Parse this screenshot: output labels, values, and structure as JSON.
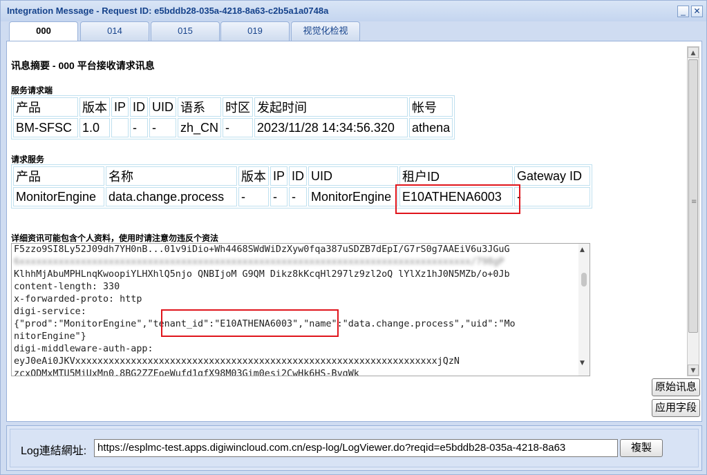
{
  "window": {
    "title": "Integration Message - Request ID: e5bddb28-035a-4218-8a63-c2b5a1a0748a",
    "minimize_label": "_",
    "close_label": "✕"
  },
  "tabs": [
    {
      "label": "000",
      "active": true
    },
    {
      "label": "014"
    },
    {
      "label": "015"
    },
    {
      "label": "019"
    },
    {
      "label": "视觉化检视"
    }
  ],
  "summary": {
    "heading": "讯息摘要 - 000 平台接收请求讯息"
  },
  "requester": {
    "title": "服务请求端",
    "headers": [
      "产品",
      "版本",
      "IP",
      "ID",
      "UID",
      "语系",
      "时区",
      "发起时间",
      "帐号"
    ],
    "values": [
      "BM-SFSC",
      "1.0",
      "",
      "-",
      "-",
      "zh_CN",
      "-",
      "2023/11/28 14:34:56.320",
      "athena"
    ]
  },
  "service": {
    "title": "请求服务",
    "headers": [
      "产品",
      "名称",
      "版本",
      "IP",
      "ID",
      "UID",
      "租户ID",
      "Gateway ID"
    ],
    "values": [
      "MonitorEngine",
      "data.change.process",
      "-",
      "-",
      "-",
      "MonitorEngine",
      "E10ATHENA6003",
      "-"
    ]
  },
  "detail": {
    "title": "详细资讯可能包含个人资料，使用时请注意勿违反个资法",
    "lines": [
      {
        "text": "F5zzo9SI8Ly52J09dh7YH0nB...01v9iDio+Wh4468SWdWiDzXyw0fqa387uSDZB7dEpI/G7rS0g7AAEiV6u3JGuG",
        "blur": false
      },
      {
        "text": "6xxxxxxxxxxxxxxxxxxxxxxxxxxxxxxxxxxxxxxxxxxxxxxxxxxxxxxxxxxxxxxxxxxxxxxxxxxxxxxxxx/798gP",
        "blur": true
      },
      {
        "text": "KlhhMjAbuMPHLnqKwoopiYLHXhlQ5njo QNBIjoM G9QM Dikz8kKcqHl297lz9zl2oQ lYlXz1hJ0N5MZb/o+0Jb",
        "blur": false
      },
      {
        "text": "content-length: 330",
        "blur": false
      },
      {
        "text": "x-forwarded-proto: http",
        "blur": false
      },
      {
        "text": "digi-service:",
        "blur": false
      },
      {
        "text": "{\"prod\":\"MonitorEngine\",\"tenant_id\":\"E10ATHENA6003\",\"name\":\"data.change.process\",\"uid\":\"Mo",
        "blur": false
      },
      {
        "text": "nitorEngine\"}",
        "blur": false
      },
      {
        "text": "digi-middleware-auth-app:",
        "blur": false
      },
      {
        "text": "eyJ0eAi0JKVxxxxxxxxxxxxxxxxxxxxxxxxxxxxxxxxxxxxxxxxxxxxxxxxxxxxxxxxxxxxxxxxxjQzN",
        "blur": false
      },
      {
        "text": "zcxODMxMTU5MjUxMn0.8BG2ZZFoeWufd1gfX98M03Gim0esi2CwHk6HS-BygWk",
        "blur": false
      }
    ]
  },
  "buttons": {
    "raw_message": "原始讯息",
    "apply_fields": "应用字段",
    "copy": "複製"
  },
  "footer": {
    "label": "Log連結網址:",
    "url": "https://esplmc-test.apps.digiwincloud.com.cn/esp-log/LogViewer.do?reqid=e5bddb28-035a-4218-8a63"
  },
  "colors": {
    "highlight": "#e0141b",
    "title_text": "#15428b",
    "window_bg": "#cfdcf1"
  }
}
